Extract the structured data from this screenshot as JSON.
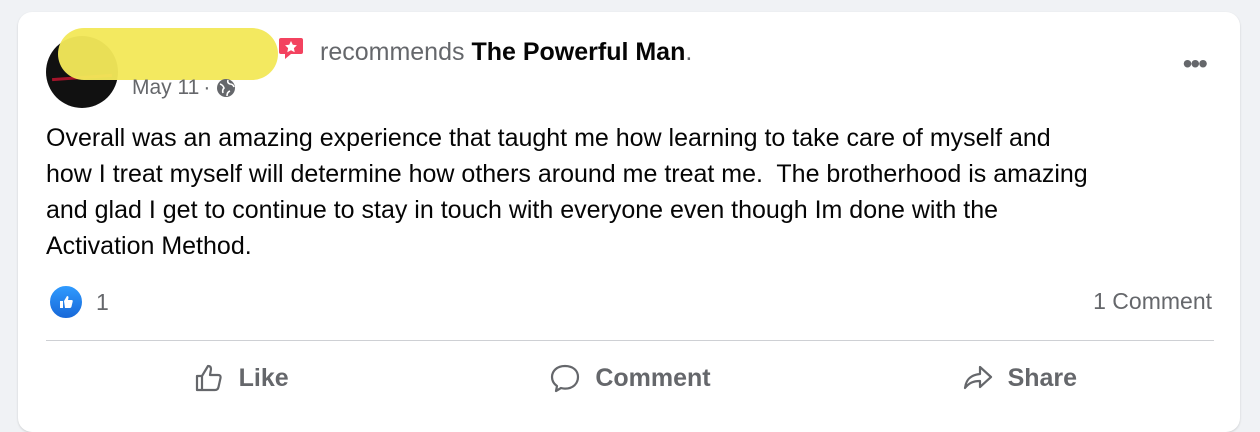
{
  "post": {
    "action_text": "recommends",
    "page_name": "The Powerful Man",
    "period": ".",
    "date": "May 11",
    "separator": "·",
    "body": "Overall was an amazing experience that taught me how learning to take care of myself and\nhow I treat myself will determine how others around me treat me.  The brotherhood is amazing\nand glad I get to continue to stay in touch with everyone even though Im done with the\nActivation Method.",
    "more_label": "•••"
  },
  "engagement": {
    "reaction_count": "1",
    "comment_count": "1 Comment"
  },
  "actions": {
    "like_label": "Like",
    "comment_label": "Comment",
    "share_label": "Share"
  },
  "colors": {
    "accent": "#1877f2",
    "recommend_icon": "#f3425f",
    "redaction": "#f2e85a",
    "secondary_text": "#65676b"
  },
  "icons": {
    "recommend": "recommend-star-icon",
    "privacy": "globe-icon",
    "reaction": "like-reaction-icon",
    "like": "thumbs-up-icon",
    "comment": "speech-bubble-icon",
    "share": "share-arrow-icon",
    "more": "more-options-icon"
  }
}
